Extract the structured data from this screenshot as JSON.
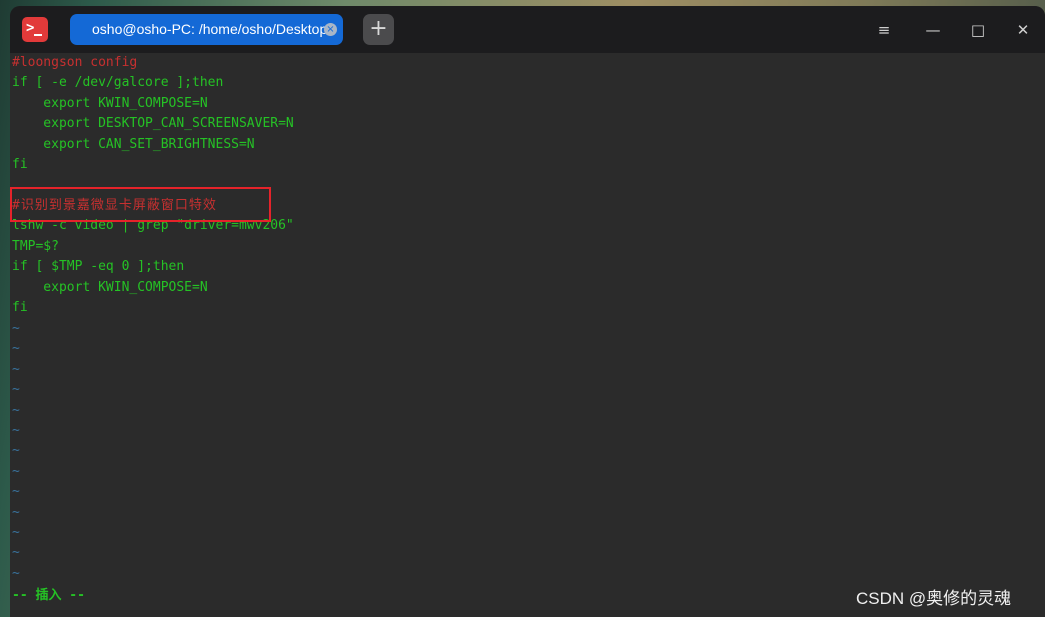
{
  "tab": {
    "title": "osho@osho-PC: /home/osho/Desktop",
    "close": "×"
  },
  "newtab": "+",
  "window_controls": {
    "menu": "≡",
    "minimize": "—",
    "maximize": "□",
    "close": "✕"
  },
  "lines": [
    "#loongson config",
    "if [ -e /dev/galcore ];then",
    "    export KWIN_COMPOSE=N",
    "    export DESKTOP_CAN_SCREENSAVER=N",
    "    export CAN_SET_BRIGHTNESS=N",
    "fi",
    "",
    "#识别到景嘉微显卡屏蔽窗口特效",
    "lshw -c video | grep \"driver=mwv206\"",
    "TMP=$?",
    "if [ $TMP -eq 0 ];then",
    "    export KWIN_COMPOSE=N",
    "fi"
  ],
  "tilde": "~",
  "status": "-- 插入 --",
  "watermark": "CSDN @奥修的灵魂",
  "colors": {
    "comment": "#c73030",
    "code": "#25c225",
    "tilde": "#39739d",
    "accent": "#1469d6",
    "highlight": "#e5232a"
  }
}
